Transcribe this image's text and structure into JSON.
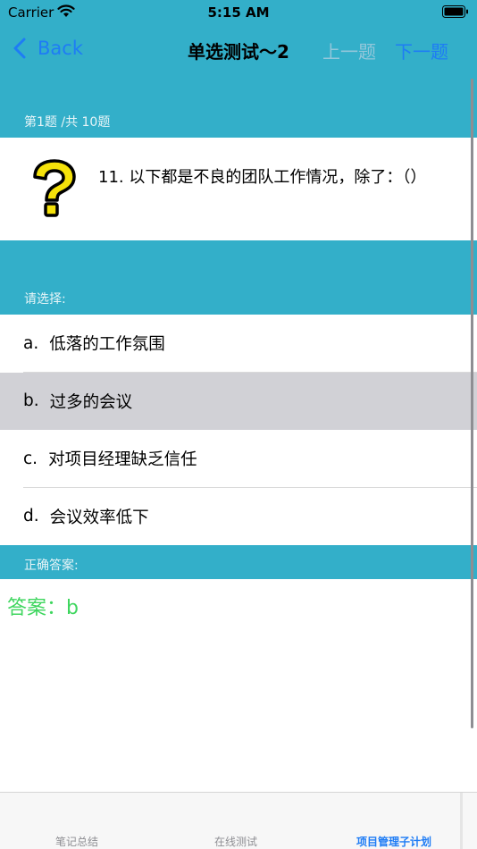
{
  "status_bar": {
    "carrier": "Carrier",
    "time": "5:15 AM",
    "wifi_icon": "wifi-icon",
    "battery_icon": "battery-icon"
  },
  "nav": {
    "back_label": "Back",
    "title": "单选测试～2",
    "prev_label": "上一题",
    "next_label": "下一题",
    "back_icon": "chevron-left-icon"
  },
  "question": {
    "count_text": "第1题 /共 10题",
    "icon": "question-mark-icon",
    "text": "11.  以下都是不良的团队工作情况，除了：（）"
  },
  "choose_label": "请选择:",
  "options": [
    {
      "letter": "a.",
      "text": "低落的工作氛围",
      "selected": false
    },
    {
      "letter": "b.",
      "text": "过多的会议",
      "selected": true
    },
    {
      "letter": "c.",
      "text": "对项目经理缺乏信任",
      "selected": false
    },
    {
      "letter": "d.",
      "text": "会议效率低下",
      "selected": false
    }
  ],
  "answer": {
    "label": "正确答案:",
    "text": "答案：b"
  },
  "tabs": [
    {
      "label": "笔记总结",
      "active": false
    },
    {
      "label": "在线测试",
      "active": false
    },
    {
      "label": "项目管理子计划",
      "active": true
    }
  ],
  "colors": {
    "teal": "#33AFC9",
    "link_blue": "#1E7CF5",
    "disabled_blue": "#93C7DA",
    "selected_gray": "#D1D1D6",
    "answer_green": "#3FD65F"
  }
}
